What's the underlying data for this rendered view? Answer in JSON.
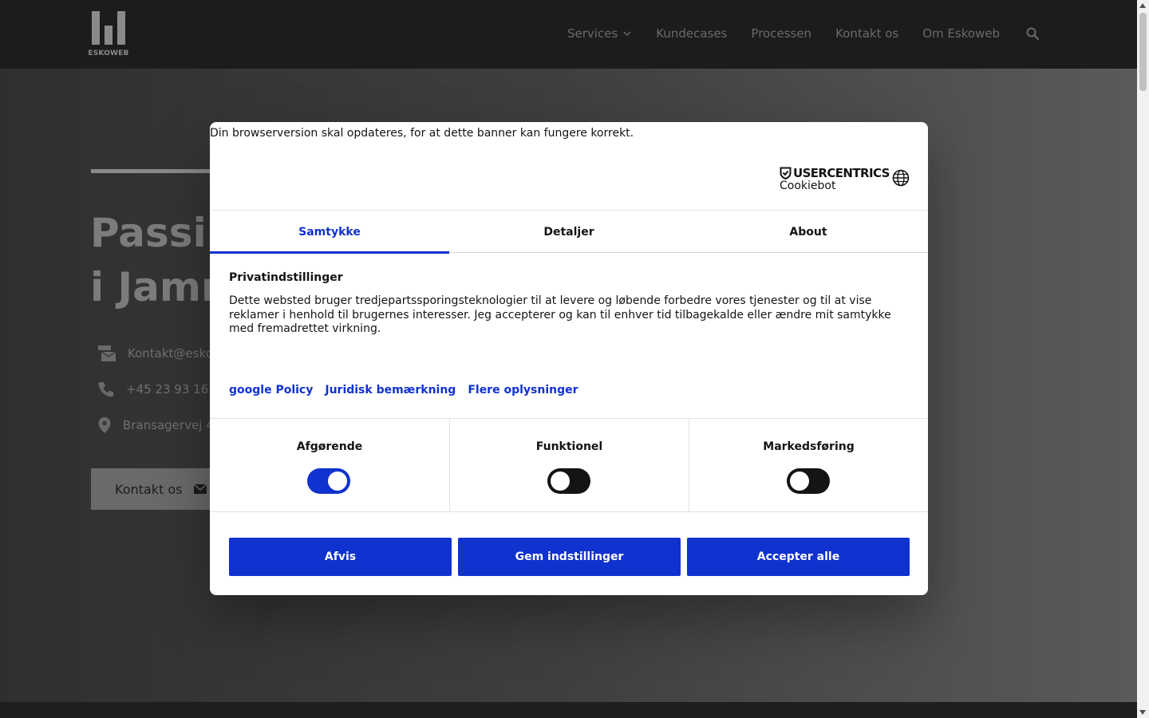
{
  "site": {
    "logo_text": "ESKOWEB",
    "nav": [
      {
        "label": "Services"
      },
      {
        "label": "Kundecases"
      },
      {
        "label": "Processen"
      },
      {
        "label": "Kontakt os"
      },
      {
        "label": "Om Eskoweb"
      }
    ],
    "hero": {
      "title_line1": "Passi",
      "title_line2": "i Jamm",
      "email": "Kontakt@esko",
      "phone": "+45 23 93 16 9",
      "address": "Bransagervej 4",
      "button_label": "Kontakt os"
    }
  },
  "dialog": {
    "browser_warning": "Din browserversion skal opdateres, for at dette banner kan fungere korrekt.",
    "brand_name": "USERCENTRICS",
    "brand_sub": "Cookiebot",
    "tabs": [
      {
        "label": "Samtykke"
      },
      {
        "label": "Detaljer"
      },
      {
        "label": "About"
      }
    ],
    "privacy_title": "Privatindstillinger",
    "privacy_text": "Dette websted bruger tredjepartssporingsteknologier til at levere og løbende forbedre vores tjenester og til at vise reklamer i henhold til brugernes interesser. Jeg accepterer og kan til enhver tid tilbagekalde eller ændre mit samtykke med fremadrettet virkning.",
    "links": [
      {
        "label": "google Policy"
      },
      {
        "label": "Juridisk bemærkning"
      },
      {
        "label": "Flere oplysninger"
      }
    ],
    "categories": [
      {
        "label": "Afgørende",
        "enabled": true
      },
      {
        "label": "Funktionel",
        "enabled": false
      },
      {
        "label": "Markedsføring",
        "enabled": false
      }
    ],
    "buttons": [
      {
        "label": "Afvis"
      },
      {
        "label": "Gem indstillinger"
      },
      {
        "label": "Accepter alle"
      }
    ]
  },
  "colors": {
    "accent": "#1032cf",
    "toggle_off": "#141414",
    "header_bg": "#1c1c1c"
  }
}
